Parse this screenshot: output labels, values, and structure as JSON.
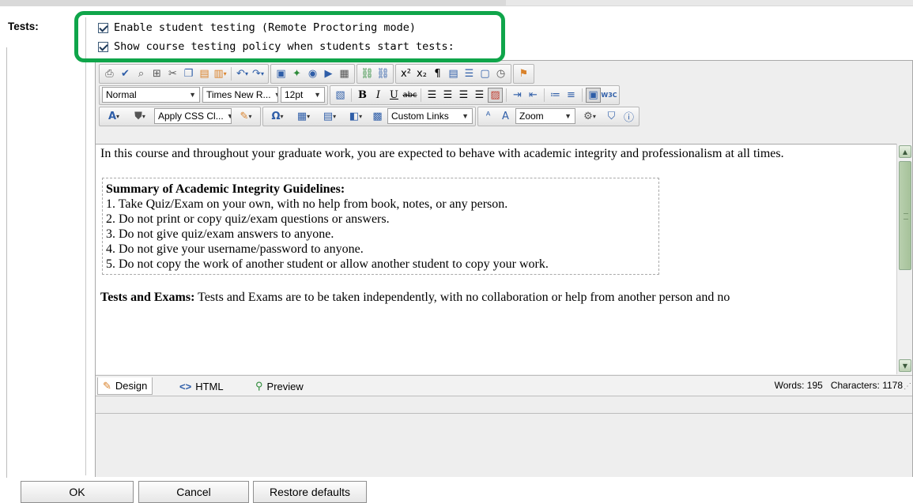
{
  "tests_label": "Tests:",
  "options": [
    {
      "label": "Enable student testing (Remote Proctoring mode)",
      "checked": true
    },
    {
      "label": "Show course testing policy when students start tests:",
      "checked": true
    }
  ],
  "highlight_color": "#0fa54a",
  "toolbar": {
    "style_select": "Normal",
    "font_select": "Times New R...",
    "size_select": "12pt",
    "css_select": "Apply CSS Cl...",
    "links_select": "Custom Links",
    "zoom_select": "Zoom",
    "bold": "B",
    "italic": "I",
    "underline": "U",
    "strike": "abc",
    "omega": "Ω",
    "w3c": "W3C"
  },
  "content": {
    "intro": "In this course and throughout your graduate work, you are expected to behave with academic integrity and professionalism at all times.",
    "summary_title": "Summary of Academic Integrity Guidelines:",
    "guidelines": [
      "1. Take Quiz/Exam on your own, with no help from book, notes, or any person.",
      "2. Do not print or copy quiz/exam questions or answers.",
      "3. Do not give quiz/exam answers to anyone.",
      "4. Do not give your username/password to anyone.",
      "5. Do not copy the work of another student or allow another student to copy your work."
    ],
    "tests_heading": "Tests and Exams:",
    "tests_text": "Tests and Exams are to be taken independently, with no collaboration or help from another person and no"
  },
  "modes": {
    "design": "Design",
    "html": "HTML",
    "preview": "Preview"
  },
  "stats": {
    "words_label": "Words:",
    "words": "195",
    "chars_label": "Characters:",
    "chars": "1178"
  },
  "buttons": {
    "ok": "OK",
    "cancel": "Cancel",
    "restore": "Restore defaults"
  }
}
